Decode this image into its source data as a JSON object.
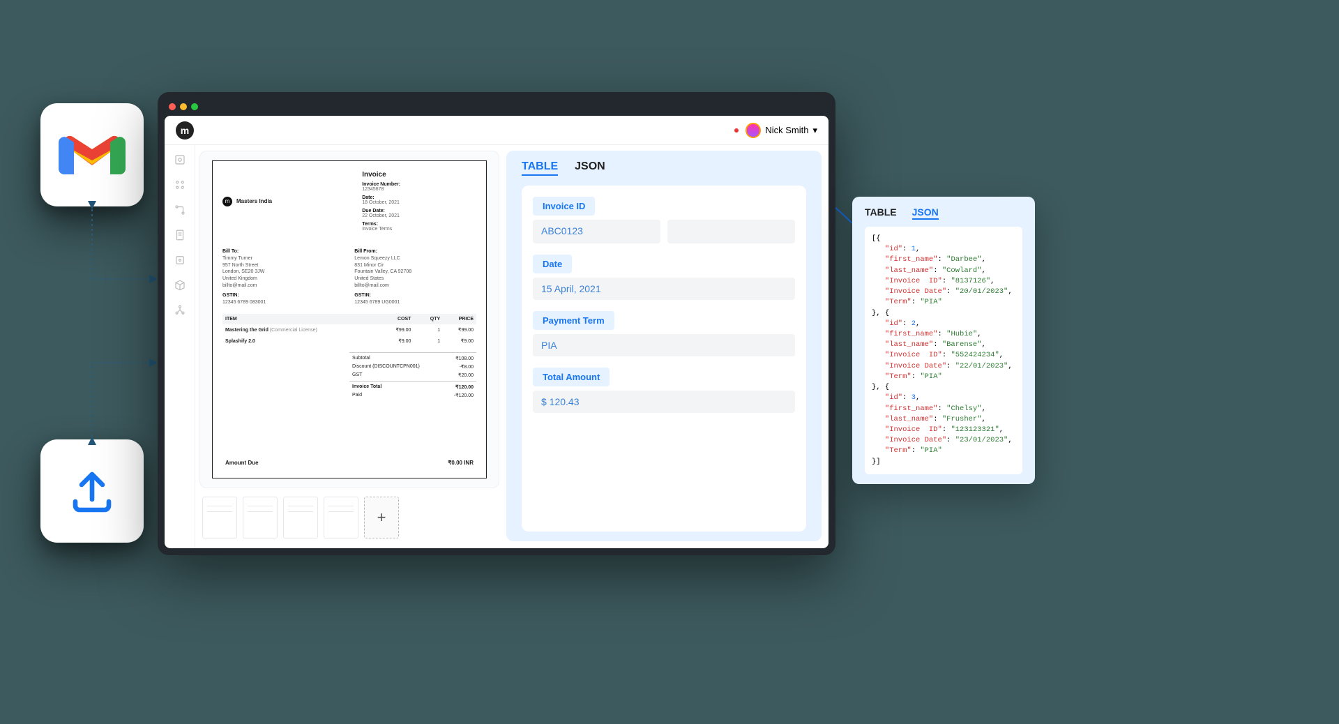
{
  "user": {
    "name": "Nick Smith"
  },
  "sidebar_icons": [
    "home",
    "apps",
    "flow",
    "doc",
    "scan",
    "box",
    "share"
  ],
  "invoice": {
    "company": "Masters India",
    "heading": "Invoice",
    "meta": {
      "number_label": "Invoice Number:",
      "number": "12345678",
      "date_label": "Date:",
      "date": "18 October, 2021",
      "due_label": "Due Date:",
      "due": "22 October, 2021",
      "terms_label": "Terms:",
      "terms": "Invoice Terms"
    },
    "bill_to": {
      "label": "Bill To:",
      "name": "Timmy Turner",
      "street": "957 North Street",
      "city": "London, SE20 3JW",
      "country": "United Kingdom",
      "email": "billto@mail.com",
      "gstin_label": "GSTIN:",
      "gstin": "12345 6789 083001"
    },
    "bill_from": {
      "label": "Bill From:",
      "name": "Lemon Squeezy LLC",
      "street": "831 Minor Cir",
      "city": "Fountain Valley, CA 92708",
      "country": "United States",
      "email": "billto@mail.com",
      "gstin_label": "GSTIN:",
      "gstin": "12345 6789 UG0001"
    },
    "table_headers": {
      "item": "ITEM",
      "cost": "COST",
      "qty": "QTY",
      "price": "PRICE"
    },
    "lines": [
      {
        "item": "Mastering the Grid",
        "note": "(Commercial License)",
        "cost": "₹99.00",
        "qty": "1",
        "price": "₹99.00"
      },
      {
        "item": "Splashify 2.0",
        "note": "",
        "cost": "₹9.00",
        "qty": "1",
        "price": "₹9.00"
      }
    ],
    "totals": {
      "subtotal_l": "Subtotal",
      "subtotal_v": "₹108.00",
      "discount_l": "Discount (DISCOUNTCPN001)",
      "discount_v": "-₹8.00",
      "gst_l": "GST",
      "gst_v": "₹20.00",
      "total_l": "Invoice Total",
      "total_v": "₹120.00",
      "paid_l": "Paid",
      "paid_v": "-₹120.00",
      "due_l": "Amount Due",
      "due_v": "₹0.00 INR"
    }
  },
  "tabs": {
    "table": "TABLE",
    "json": "JSON"
  },
  "fields": [
    {
      "label": "Invoice ID",
      "value": "ABC0123",
      "extra": true
    },
    {
      "label": "Date",
      "value": "15 April, 2021"
    },
    {
      "label": "Payment Term",
      "value": "PIA"
    },
    {
      "label": "Total Amount",
      "value": "$ 120.43"
    }
  ],
  "json_popup": {
    "tabs": {
      "table": "TABLE",
      "json": "JSON"
    },
    "records": [
      {
        "id": 1,
        "first_name": "Darbee",
        "last_name": "Cowlard",
        "Invoice  ID": "8137126",
        "Invoice Date": "20/01/2023",
        "Term": "PIA"
      },
      {
        "id": 2,
        "first_name": "Hubie",
        "last_name": "Barense",
        "Invoice  ID": "552424234",
        "Invoice Date": "22/01/2023",
        "Term": "PIA"
      },
      {
        "id": 3,
        "first_name": "Chelsy",
        "last_name": "Frusher",
        "Invoice  ID": "123123321",
        "Invoice Date": "23/01/2023",
        "Term": "PIA"
      }
    ]
  },
  "add_label": "+"
}
